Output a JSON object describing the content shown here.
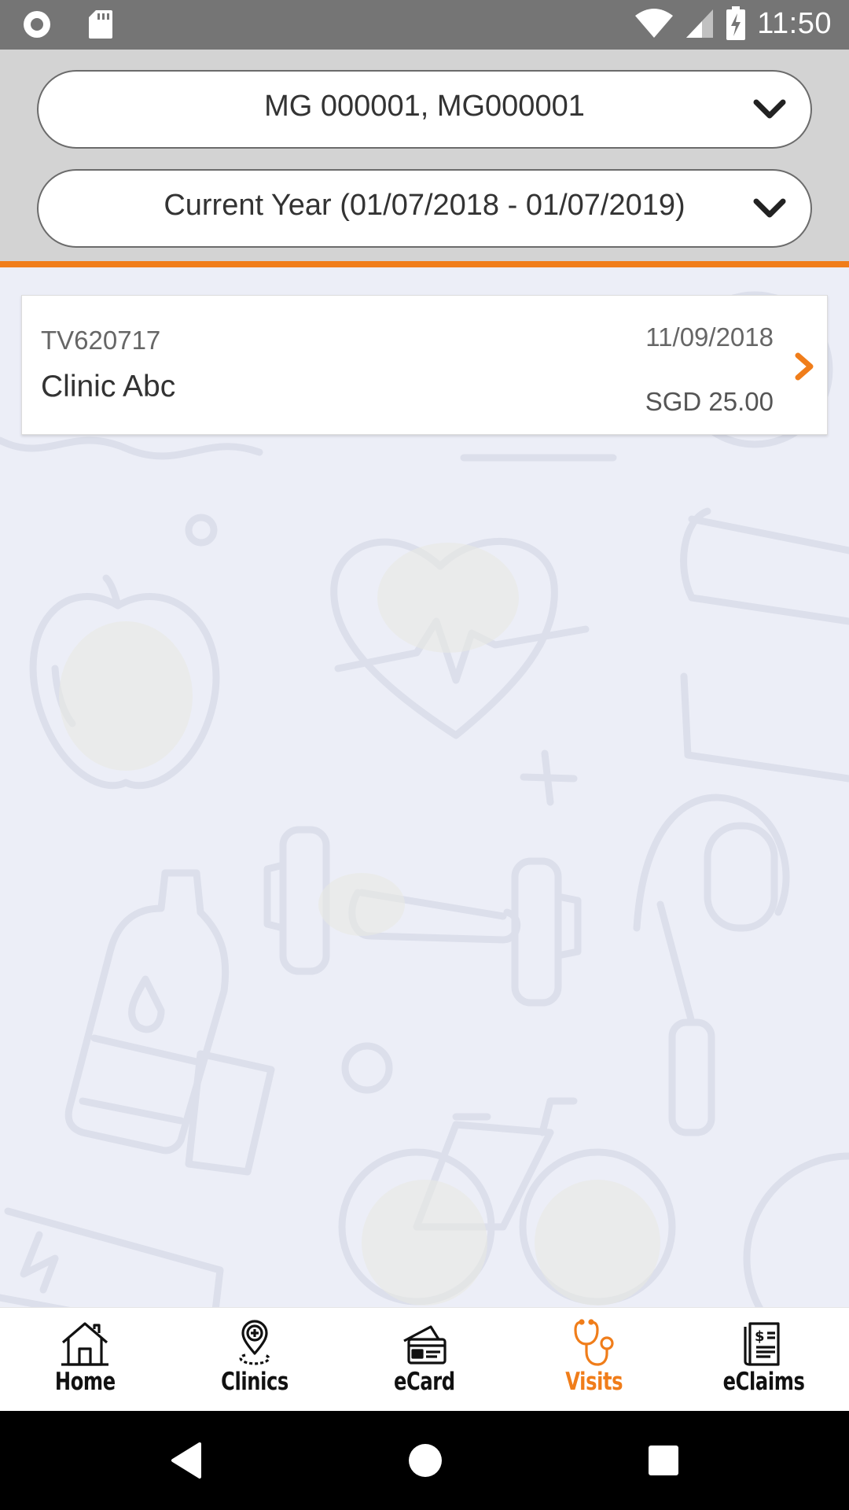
{
  "status_bar": {
    "time": "11:50",
    "icons": [
      "record-icon",
      "sd-card-icon",
      "wifi-icon",
      "cell-signal-icon",
      "battery-charging-icon"
    ]
  },
  "filters": {
    "member": {
      "value": "MG 000001, MG000001",
      "icon": "chevron-down-icon"
    },
    "period": {
      "value": "Current Year (01/07/2018 - 01/07/2019)",
      "icon": "chevron-down-icon"
    }
  },
  "visits": [
    {
      "reference": "TV620717",
      "clinic": "Clinic Abc",
      "date": "11/09/2018",
      "amount": "SGD 25.00"
    }
  ],
  "bottom_nav": {
    "items": [
      {
        "label": "Home",
        "icon": "home-icon"
      },
      {
        "label": "Clinics",
        "icon": "clinic-location-icon"
      },
      {
        "label": "eCard",
        "icon": "ecard-icon"
      },
      {
        "label": "Visits",
        "icon": "stethoscope-icon",
        "active": true
      },
      {
        "label": "eClaims",
        "icon": "eclaims-icon"
      }
    ]
  },
  "colors": {
    "accent": "#f07d1a",
    "header_bg": "#d3d3d3",
    "status_bar": "#757575",
    "page_bg": "#eceef7"
  }
}
